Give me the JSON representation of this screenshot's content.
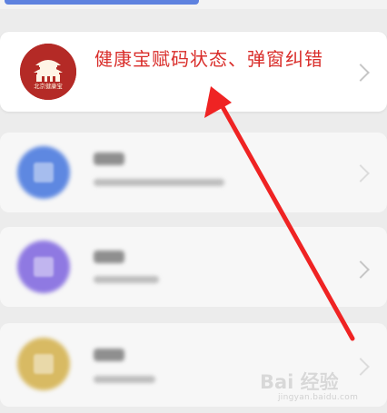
{
  "top": {
    "accent_color": "#5e82df"
  },
  "featured_item": {
    "title": "健康宝赋码状态、弹窗纠错",
    "logo_text": "北京健康宝",
    "logo_color": "#b42a26",
    "chevron_icon": "chevron-right-icon"
  },
  "blurred_items": [
    {
      "icon_color": "#5e88e1",
      "icon": "document-icon"
    },
    {
      "icon_color": "#8f79e2",
      "icon": "message-icon"
    },
    {
      "icon_color": "#d8ba63",
      "icon": "coin-icon"
    }
  ],
  "watermark": {
    "main": "Bai 经验",
    "sub": "jingyan.baidu.com"
  },
  "annotation": {
    "arrow_color": "#ef2323"
  }
}
